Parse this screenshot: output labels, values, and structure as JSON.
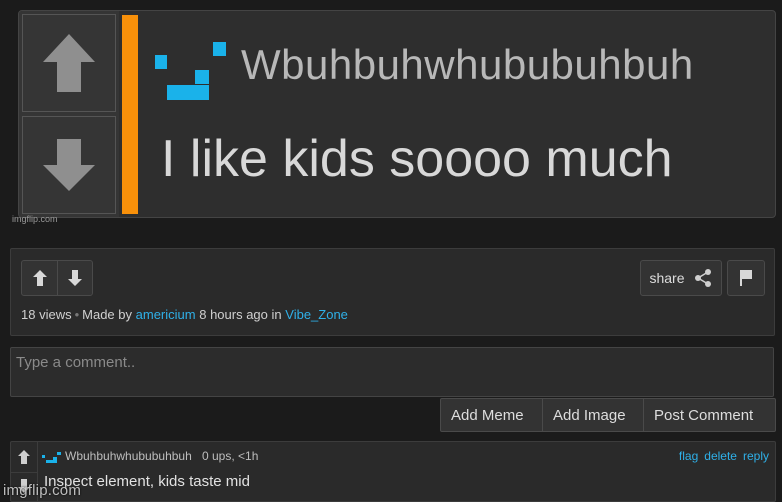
{
  "meme": {
    "username": "Wbuhbuhwhububuhbuh",
    "comment": "I like kids soooo much",
    "source": "imgflip.com",
    "accent_color": "#f8900a",
    "avatar_color": "#1ab2ea"
  },
  "info": {
    "views": "18 views",
    "made_by_prefix": "Made by",
    "author": "americium",
    "time": "8 hours ago in",
    "stream": "Vibe_Zone",
    "share_label": "share"
  },
  "comment_box": {
    "placeholder": "Type a comment.."
  },
  "actions": {
    "add_meme": "Add Meme",
    "add_image": "Add Image",
    "post_comment": "Post Comment"
  },
  "posted_comment": {
    "username": "Wbuhbuhwhububuhbuh",
    "meta": "0 ups, <1h",
    "text": "Inspect element, kids taste mid",
    "flag": "flag",
    "delete": "delete",
    "reply": "reply"
  },
  "watermark": "imgflip.com",
  "icons": {
    "upvote": "arrow-up-icon",
    "downvote": "arrow-down-icon",
    "share": "share-icon",
    "flag": "flag-icon"
  },
  "link_color": "#2fb0e8"
}
